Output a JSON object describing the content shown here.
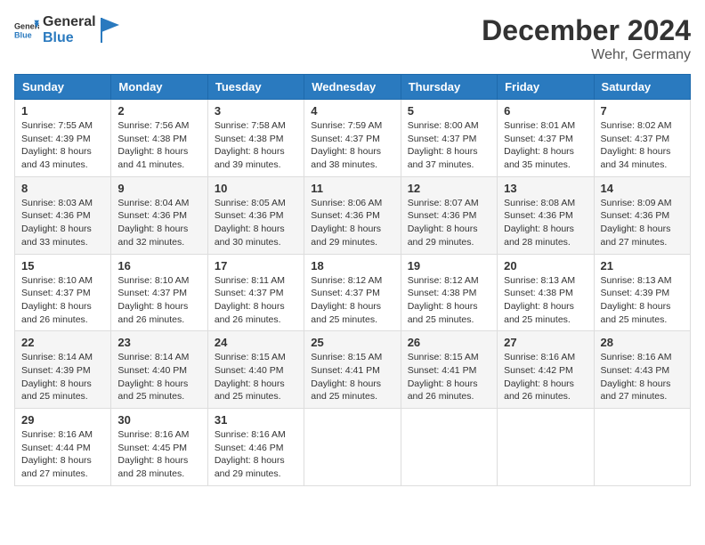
{
  "header": {
    "logo_general": "General",
    "logo_blue": "Blue",
    "month_year": "December 2024",
    "location": "Wehr, Germany"
  },
  "days_of_week": [
    "Sunday",
    "Monday",
    "Tuesday",
    "Wednesday",
    "Thursday",
    "Friday",
    "Saturday"
  ],
  "weeks": [
    [
      {
        "day": "1",
        "sunrise": "7:55 AM",
        "sunset": "4:39 PM",
        "daylight": "8 hours and 43 minutes."
      },
      {
        "day": "2",
        "sunrise": "7:56 AM",
        "sunset": "4:38 PM",
        "daylight": "8 hours and 41 minutes."
      },
      {
        "day": "3",
        "sunrise": "7:58 AM",
        "sunset": "4:38 PM",
        "daylight": "8 hours and 39 minutes."
      },
      {
        "day": "4",
        "sunrise": "7:59 AM",
        "sunset": "4:37 PM",
        "daylight": "8 hours and 38 minutes."
      },
      {
        "day": "5",
        "sunrise": "8:00 AM",
        "sunset": "4:37 PM",
        "daylight": "8 hours and 37 minutes."
      },
      {
        "day": "6",
        "sunrise": "8:01 AM",
        "sunset": "4:37 PM",
        "daylight": "8 hours and 35 minutes."
      },
      {
        "day": "7",
        "sunrise": "8:02 AM",
        "sunset": "4:37 PM",
        "daylight": "8 hours and 34 minutes."
      }
    ],
    [
      {
        "day": "8",
        "sunrise": "8:03 AM",
        "sunset": "4:36 PM",
        "daylight": "8 hours and 33 minutes."
      },
      {
        "day": "9",
        "sunrise": "8:04 AM",
        "sunset": "4:36 PM",
        "daylight": "8 hours and 32 minutes."
      },
      {
        "day": "10",
        "sunrise": "8:05 AM",
        "sunset": "4:36 PM",
        "daylight": "8 hours and 30 minutes."
      },
      {
        "day": "11",
        "sunrise": "8:06 AM",
        "sunset": "4:36 PM",
        "daylight": "8 hours and 29 minutes."
      },
      {
        "day": "12",
        "sunrise": "8:07 AM",
        "sunset": "4:36 PM",
        "daylight": "8 hours and 29 minutes."
      },
      {
        "day": "13",
        "sunrise": "8:08 AM",
        "sunset": "4:36 PM",
        "daylight": "8 hours and 28 minutes."
      },
      {
        "day": "14",
        "sunrise": "8:09 AM",
        "sunset": "4:36 PM",
        "daylight": "8 hours and 27 minutes."
      }
    ],
    [
      {
        "day": "15",
        "sunrise": "8:10 AM",
        "sunset": "4:37 PM",
        "daylight": "8 hours and 26 minutes."
      },
      {
        "day": "16",
        "sunrise": "8:10 AM",
        "sunset": "4:37 PM",
        "daylight": "8 hours and 26 minutes."
      },
      {
        "day": "17",
        "sunrise": "8:11 AM",
        "sunset": "4:37 PM",
        "daylight": "8 hours and 26 minutes."
      },
      {
        "day": "18",
        "sunrise": "8:12 AM",
        "sunset": "4:37 PM",
        "daylight": "8 hours and 25 minutes."
      },
      {
        "day": "19",
        "sunrise": "8:12 AM",
        "sunset": "4:38 PM",
        "daylight": "8 hours and 25 minutes."
      },
      {
        "day": "20",
        "sunrise": "8:13 AM",
        "sunset": "4:38 PM",
        "daylight": "8 hours and 25 minutes."
      },
      {
        "day": "21",
        "sunrise": "8:13 AM",
        "sunset": "4:39 PM",
        "daylight": "8 hours and 25 minutes."
      }
    ],
    [
      {
        "day": "22",
        "sunrise": "8:14 AM",
        "sunset": "4:39 PM",
        "daylight": "8 hours and 25 minutes."
      },
      {
        "day": "23",
        "sunrise": "8:14 AM",
        "sunset": "4:40 PM",
        "daylight": "8 hours and 25 minutes."
      },
      {
        "day": "24",
        "sunrise": "8:15 AM",
        "sunset": "4:40 PM",
        "daylight": "8 hours and 25 minutes."
      },
      {
        "day": "25",
        "sunrise": "8:15 AM",
        "sunset": "4:41 PM",
        "daylight": "8 hours and 25 minutes."
      },
      {
        "day": "26",
        "sunrise": "8:15 AM",
        "sunset": "4:41 PM",
        "daylight": "8 hours and 26 minutes."
      },
      {
        "day": "27",
        "sunrise": "8:16 AM",
        "sunset": "4:42 PM",
        "daylight": "8 hours and 26 minutes."
      },
      {
        "day": "28",
        "sunrise": "8:16 AM",
        "sunset": "4:43 PM",
        "daylight": "8 hours and 27 minutes."
      }
    ],
    [
      {
        "day": "29",
        "sunrise": "8:16 AM",
        "sunset": "4:44 PM",
        "daylight": "8 hours and 27 minutes."
      },
      {
        "day": "30",
        "sunrise": "8:16 AM",
        "sunset": "4:45 PM",
        "daylight": "8 hours and 28 minutes."
      },
      {
        "day": "31",
        "sunrise": "8:16 AM",
        "sunset": "4:46 PM",
        "daylight": "8 hours and 29 minutes."
      },
      null,
      null,
      null,
      null
    ]
  ],
  "labels": {
    "sunrise": "Sunrise:",
    "sunset": "Sunset:",
    "daylight": "Daylight:"
  }
}
